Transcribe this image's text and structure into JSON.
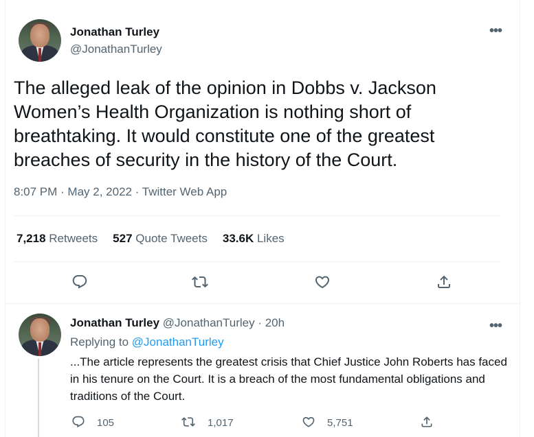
{
  "main_tweet": {
    "author_name": "Jonathan Turley",
    "author_handle": "@JonathanTurley",
    "more_label": "•••",
    "text": "The alleged leak of the opinion in Dobbs v. Jackson Women’s Health Organization is nothing short of breathtaking. It would constitute one of the greatest breaches of security in the history of the Court.",
    "meta": "8:07 PM · May 2, 2022 · Twitter Web App",
    "stats": {
      "retweets_count": "7,218",
      "retweets_label": "Retweets",
      "quotes_count": "527",
      "quotes_label": "Quote Tweets",
      "likes_count": "33.6K",
      "likes_label": "Likes"
    },
    "actions": [
      "reply-icon",
      "retweet-icon",
      "like-icon",
      "share-icon"
    ]
  },
  "reply_tweet": {
    "author_name": "Jonathan Turley",
    "author_handle": "@JonathanTurley",
    "time": "· 20h",
    "more_label": "•••",
    "replying_prefix": "Replying to",
    "replying_handle": "@JonathanTurley",
    "text": "...The article represents the greatest crisis that Chief Justice John Roberts has faced in his tenure on the Court. It is a breach of the most fundamental obligations and traditions of the Court.",
    "reply_count": "105",
    "retweet_count": "1,017",
    "like_count": "5,751"
  },
  "colors": {
    "text": "#0f1419",
    "secondary": "#536471",
    "link": "#1d9bf0",
    "border": "#eff3f4"
  }
}
